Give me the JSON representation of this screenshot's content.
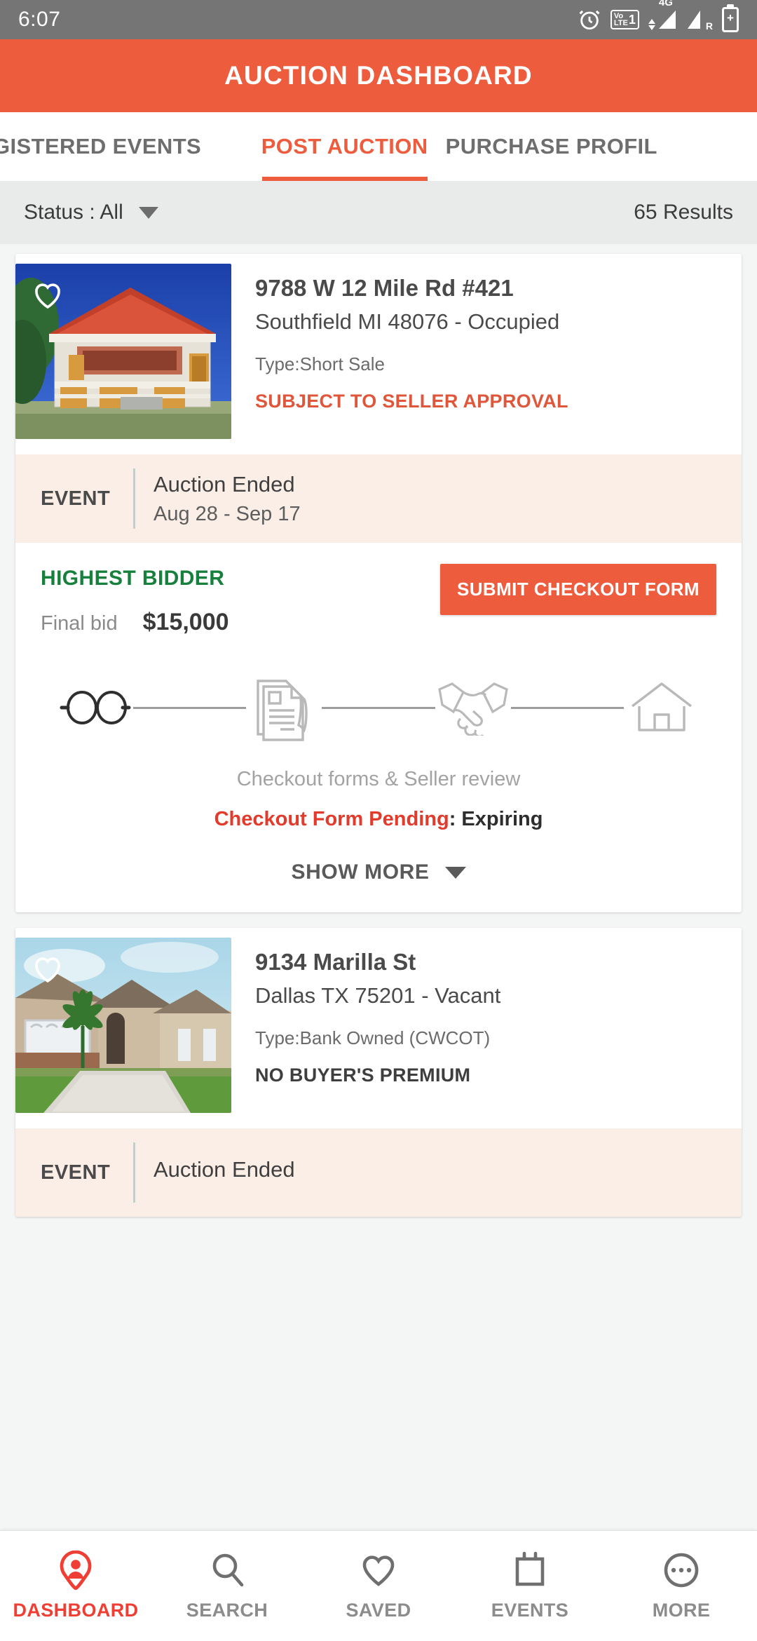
{
  "status_bar": {
    "time": "6:07",
    "icons": [
      "alarm-icon",
      "volte-icon",
      "signal-4g-icon",
      "signal-roaming-icon",
      "battery-icon"
    ],
    "volte_top": "Vo",
    "volte_bottom": "LTE",
    "sim_number": "1",
    "network_label": "4G",
    "roaming_label": "R"
  },
  "app_bar": {
    "title": "AUCTION DASHBOARD",
    "color": "#ee5c3e"
  },
  "tabs": [
    {
      "label": "GISTERED EVENTS",
      "active": false
    },
    {
      "label": "POST AUCTION",
      "active": true
    },
    {
      "label": "PURCHASE PROFIL",
      "active": false
    }
  ],
  "filter_bar": {
    "status_label": "Status : All",
    "results": "65 Results"
  },
  "cards": [
    {
      "address_line1": "9788 W 12 Mile Rd #421",
      "address_line2": "Southfield MI 48076 - Occupied",
      "type": "Type:Short Sale",
      "badge": "SUBJECT TO SELLER APPROVAL",
      "badge_color": "#e0563a",
      "event": {
        "label": "EVENT",
        "title": "Auction Ended",
        "dates": "Aug 28 - Sep 17"
      },
      "bid": {
        "status": "HIGHEST BIDDER",
        "status_color": "#16803c",
        "final_bid_label": "Final bid",
        "final_bid_value": "$15,000",
        "action_button": "SUBMIT CHECKOUT FORM"
      },
      "stepper": {
        "steps": [
          "glasses-icon",
          "document-pen-icon",
          "handshake-icon",
          "house-icon"
        ],
        "caption": "Checkout forms & Seller review",
        "pending_label": "Checkout Form Pending",
        "pending_value": ": Expiring"
      },
      "show_more": "SHOW MORE"
    },
    {
      "address_line1": "9134 Marilla St",
      "address_line2": "Dallas TX 75201 - Vacant",
      "type": "Type:Bank Owned (CWCOT)",
      "badge": "NO BUYER'S PREMIUM",
      "badge_color": "#3e3e3e",
      "event": {
        "label": "EVENT",
        "title": "Auction Ended",
        "dates": ""
      }
    }
  ],
  "bottom_nav": [
    {
      "label": "DASHBOARD",
      "icon": "user-pin-icon",
      "active": true
    },
    {
      "label": "SEARCH",
      "icon": "search-icon",
      "active": false
    },
    {
      "label": "SAVED",
      "icon": "heart-icon",
      "active": false
    },
    {
      "label": "EVENTS",
      "icon": "calendar-icon",
      "active": false
    },
    {
      "label": "MORE",
      "icon": "more-ellipsis-icon",
      "active": false
    }
  ]
}
